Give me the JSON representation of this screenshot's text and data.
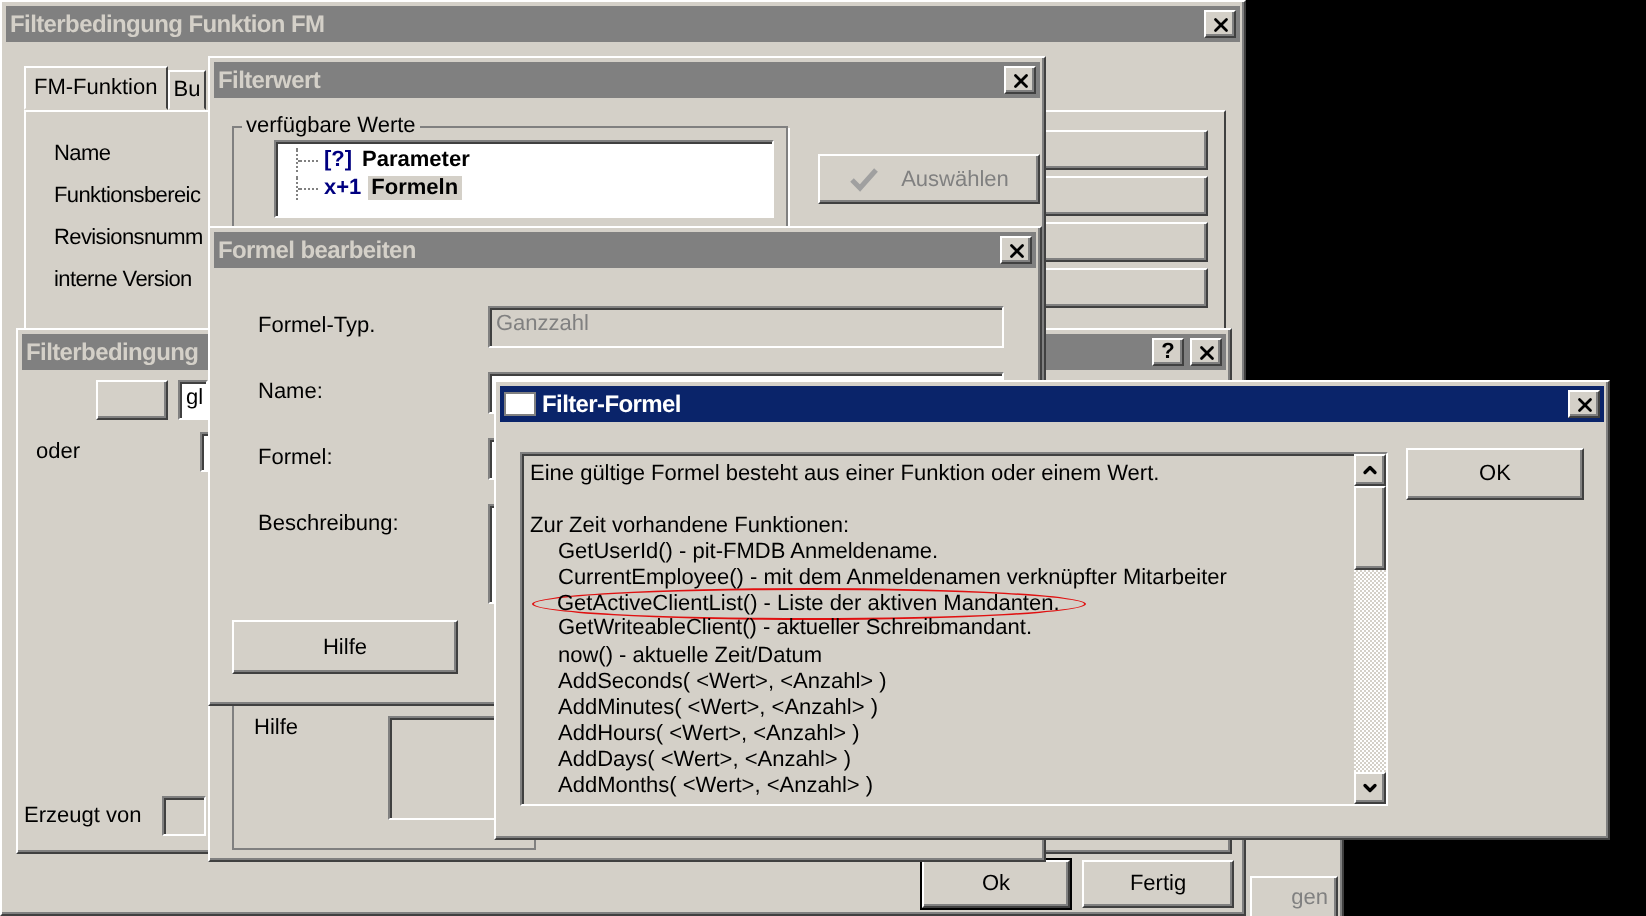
{
  "main_window": {
    "title": "Filterbedingung Funktion FM",
    "active": false,
    "tabs": [
      {
        "label": "FM-Funktion",
        "selected": true
      },
      {
        "label": "Bu",
        "selected": false
      }
    ],
    "fields": [
      {
        "label": "Name"
      },
      {
        "label": "Funktionsbereic"
      },
      {
        "label": "Revisionsnumm"
      },
      {
        "label": "interne Version"
      }
    ],
    "buttons": [
      {
        "label": "Ok",
        "default": true
      },
      {
        "label": "Fertig",
        "default": false
      }
    ]
  },
  "back_window": {
    "button": {
      "label": "gen",
      "disabled": true
    }
  },
  "condition_window": {
    "title": "Filterbedingung",
    "active": false,
    "title_buttons": [
      "?"
    ],
    "operator_value": "gl",
    "or_label": "oder",
    "created_by_label": "Erzeugt von"
  },
  "filter_value_window": {
    "title": "Filterwert",
    "active": false,
    "group_label": "verfügbare Werte",
    "tree": [
      {
        "icon": "[?]",
        "label": "Parameter",
        "selected": false
      },
      {
        "icon": "x+1",
        "label": "Formeln",
        "selected": true
      }
    ],
    "select_button": {
      "label": "Auswählen",
      "disabled": true
    },
    "help_label": "Hilfe"
  },
  "edit_formula_window": {
    "title": "Formel bearbeiten",
    "active": false,
    "fields": [
      {
        "label": "Formel-Typ.",
        "value": "Ganzzahl",
        "disabled": true,
        "kind": "line"
      },
      {
        "label": "Name:",
        "disabled": false,
        "kind": "line"
      },
      {
        "label": "Formel:",
        "disabled": false,
        "kind": "line"
      },
      {
        "label": "Beschreibung:",
        "disabled": false,
        "kind": "area"
      }
    ],
    "help_button": "Hilfe"
  },
  "filter_formula_dialog": {
    "title": "Filter-Formel",
    "active": true,
    "intro": "Eine gültige Formel besteht aus einer Funktion oder einem Wert.",
    "heading": "Zur Zeit vorhandene Funktionen:",
    "functions": [
      {
        "text": "GetUserId() - pit-FMDB Anmeldename.",
        "circled": false
      },
      {
        "text": "CurrentEmployee() - mit dem Anmeldenamen verknüpfter Mitarbeiter",
        "circled": false
      },
      {
        "text": "GetActiveClientList() - Liste der aktiven Mandanten.",
        "circled": true
      },
      {
        "text": "GetWriteableClient() - aktueller Schreibmandant.",
        "circled": false
      },
      {
        "text": "now() - aktuelle Zeit/Datum",
        "circled": false
      },
      {
        "text": "AddSeconds( <Wert>, <Anzahl> )",
        "circled": false
      },
      {
        "text": "AddMinutes( <Wert>, <Anzahl> )",
        "circled": false
      },
      {
        "text": "AddHours( <Wert>, <Anzahl> )",
        "circled": false
      },
      {
        "text": "AddDays( <Wert>, <Anzahl> )",
        "circled": false
      },
      {
        "text": "AddMonths( <Wert>, <Anzahl> )",
        "circled": false
      }
    ],
    "ok_button": "OK"
  }
}
